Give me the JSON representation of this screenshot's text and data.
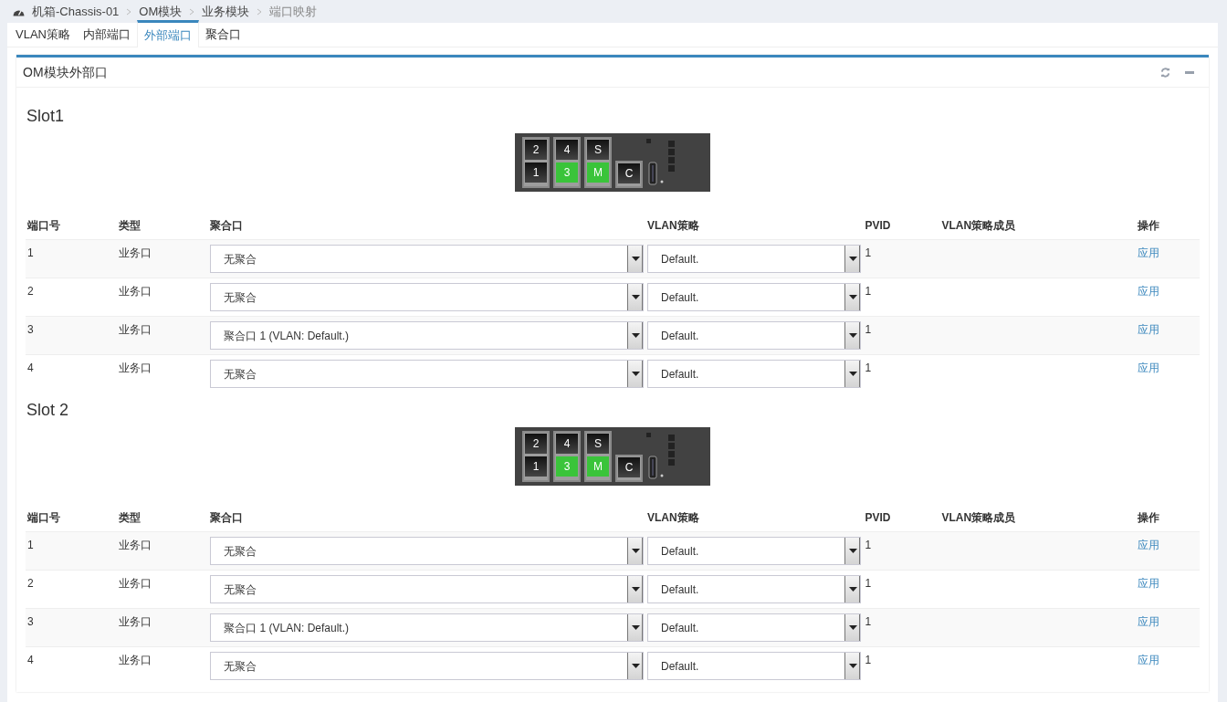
{
  "breadcrumb": [
    {
      "label": "机箱-Chassis-01",
      "current": false
    },
    {
      "label": "OM模块",
      "current": false
    },
    {
      "label": "业务模块",
      "current": false
    },
    {
      "label": "端口映射",
      "current": true
    }
  ],
  "tabs": [
    {
      "label": "VLAN策略",
      "selected": false
    },
    {
      "label": "内部端口",
      "selected": false
    },
    {
      "label": "外部端口",
      "selected": true
    },
    {
      "label": "聚合口",
      "selected": false
    }
  ],
  "panel": {
    "title": "OM模块外部口",
    "slots": [
      {
        "title": "Slot1",
        "device": {
          "port_groups": [
            {
              "kind": "sfp",
              "ports": [
                {
                  "label": "2",
                  "active": false
                },
                {
                  "label": "1",
                  "active": false
                }
              ]
            },
            {
              "kind": "rj45",
              "ports": [
                {
                  "label": "4",
                  "active": false
                },
                {
                  "label": "3",
                  "active": true
                }
              ]
            },
            {
              "kind": "rj45",
              "ports": [
                {
                  "label": "S",
                  "active": false
                },
                {
                  "label": "M",
                  "active": true
                }
              ]
            },
            {
              "kind": "console",
              "ports": [
                {
                  "label": "C",
                  "active": false
                }
              ]
            }
          ]
        },
        "columns": [
          "端口号",
          "类型",
          "聚合口",
          "VLAN策略",
          "PVID",
          "VLAN策略成员",
          "操作"
        ],
        "rows": [
          {
            "port": "1",
            "type": "业务口",
            "aggregation": "无聚合",
            "vlan_policy": "Default.",
            "pvid": "1",
            "action": "应用"
          },
          {
            "port": "2",
            "type": "业务口",
            "aggregation": "无聚合",
            "vlan_policy": "Default.",
            "pvid": "1",
            "action": "应用"
          },
          {
            "port": "3",
            "type": "业务口",
            "aggregation": "聚合口 1 (VLAN: Default.)",
            "vlan_policy": "Default.",
            "pvid": "1",
            "action": "应用"
          },
          {
            "port": "4",
            "type": "业务口",
            "aggregation": "无聚合",
            "vlan_policy": "Default.",
            "pvid": "1",
            "action": "应用"
          }
        ]
      },
      {
        "title": "Slot 2",
        "device": {
          "port_groups": [
            {
              "kind": "sfp",
              "ports": [
                {
                  "label": "2",
                  "active": false
                },
                {
                  "label": "1",
                  "active": false
                }
              ]
            },
            {
              "kind": "rj45",
              "ports": [
                {
                  "label": "4",
                  "active": false
                },
                {
                  "label": "3",
                  "active": true
                }
              ]
            },
            {
              "kind": "rj45",
              "ports": [
                {
                  "label": "S",
                  "active": false
                },
                {
                  "label": "M",
                  "active": true
                }
              ]
            },
            {
              "kind": "console",
              "ports": [
                {
                  "label": "C",
                  "active": false
                }
              ]
            }
          ]
        },
        "columns": [
          "端口号",
          "类型",
          "聚合口",
          "VLAN策略",
          "PVID",
          "VLAN策略成员",
          "操作"
        ],
        "rows": [
          {
            "port": "1",
            "type": "业务口",
            "aggregation": "无聚合",
            "vlan_policy": "Default.",
            "pvid": "1",
            "action": "应用"
          },
          {
            "port": "2",
            "type": "业务口",
            "aggregation": "无聚合",
            "vlan_policy": "Default.",
            "pvid": "1",
            "action": "应用"
          },
          {
            "port": "3",
            "type": "业务口",
            "aggregation": "聚合口 1 (VLAN: Default.)",
            "vlan_policy": "Default.",
            "pvid": "1",
            "action": "应用"
          },
          {
            "port": "4",
            "type": "业务口",
            "aggregation": "无聚合",
            "vlan_policy": "Default.",
            "pvid": "1",
            "action": "应用"
          }
        ]
      }
    ]
  }
}
